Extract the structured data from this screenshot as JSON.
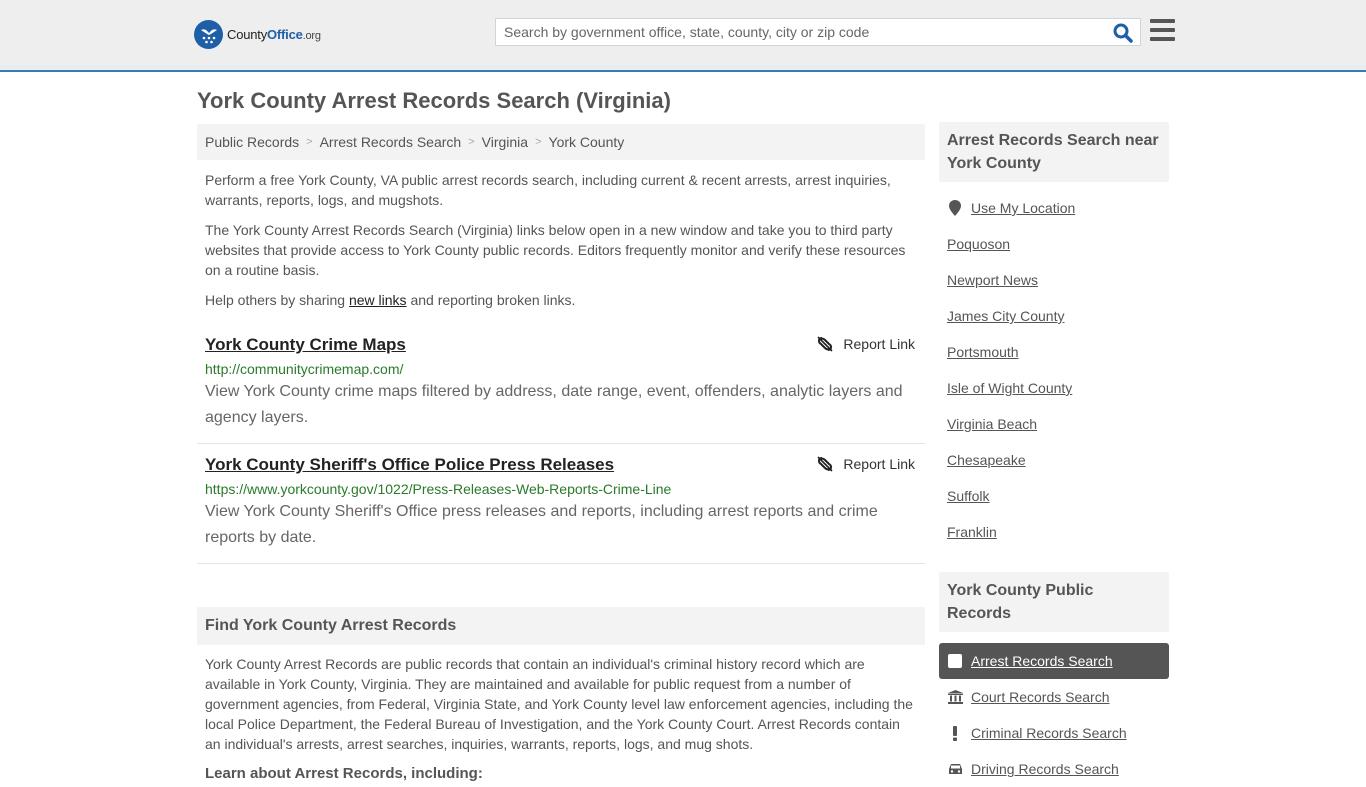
{
  "header": {
    "logo": {
      "brand_first": "County",
      "brand_second": "Office",
      "brand_suffix": ".org"
    },
    "search": {
      "placeholder": "Search by government office, state, county, city or zip code",
      "value": ""
    },
    "accent_color": "#1e5fa8",
    "border_color": "#3a7bb0"
  },
  "page": {
    "title": "York County Arrest Records Search (Virginia)",
    "breadcrumb": [
      {
        "label": "Public Records"
      },
      {
        "label": "Arrest Records Search"
      },
      {
        "label": "Virginia"
      },
      {
        "label": "York County"
      }
    ],
    "breadcrumb_separator": ">",
    "intro": {
      "p1": "Perform a free York County, VA public arrest records search, including current & recent arrests, arrest inquiries, warrants, reports, logs, and mugshots.",
      "p2": "The York County Arrest Records Search (Virginia) links below open in a new window and take you to third party websites that provide access to York County public records. Editors frequently monitor and verify these resources on a routine basis.",
      "p3_before": "Help others by sharing ",
      "p3_link": "new links",
      "p3_after": " and reporting broken links."
    },
    "links": [
      {
        "title": "York County Crime Maps",
        "url": "http://communitycrimemap.com/",
        "description": "View York County crime maps filtered by address, date range, event, offenders, analytic layers and agency layers.",
        "report_label": "Report Link"
      },
      {
        "title": "York County Sheriff's Office Police Press Releases",
        "url": "https://www.yorkcounty.gov/1022/Press-Releases-Web-Reports-Crime-Line",
        "description": "View York County Sheriff's Office press releases and reports, including arrest reports and crime reports by date.",
        "report_label": "Report Link"
      }
    ],
    "find_section": {
      "heading": "Find York County Arrest Records",
      "body": "York County Arrest Records are public records that contain an individual's criminal history record which are available in York County, Virginia. They are maintained and available for public request from a number of government agencies, from Federal, Virginia State, and York County level law enforcement agencies, including the local Police Department, the Federal Bureau of Investigation, and the York County Court. Arrest Records contain an individual's arrests, arrest searches, inquiries, warrants, reports, logs, and mug shots.",
      "learn_heading": "Learn about Arrest Records, including:"
    }
  },
  "sidebar": {
    "nearby": {
      "heading": "Arrest Records Search near York County",
      "use_location": "Use My Location",
      "places": [
        "Poquoson",
        "Newport News",
        "James City County",
        "Portsmouth",
        "Isle of Wight County",
        "Virginia Beach",
        "Chesapeake",
        "Suffolk",
        "Franklin"
      ]
    },
    "public_records": {
      "heading": "York County Public Records",
      "items": [
        {
          "label": "Arrest Records Search",
          "icon": "square-icon",
          "active": true
        },
        {
          "label": "Court Records Search",
          "icon": "courthouse-icon",
          "active": false
        },
        {
          "label": "Criminal Records Search",
          "icon": "exclamation-icon",
          "active": false
        },
        {
          "label": "Driving Records Search",
          "icon": "car-icon",
          "active": false
        }
      ]
    }
  }
}
